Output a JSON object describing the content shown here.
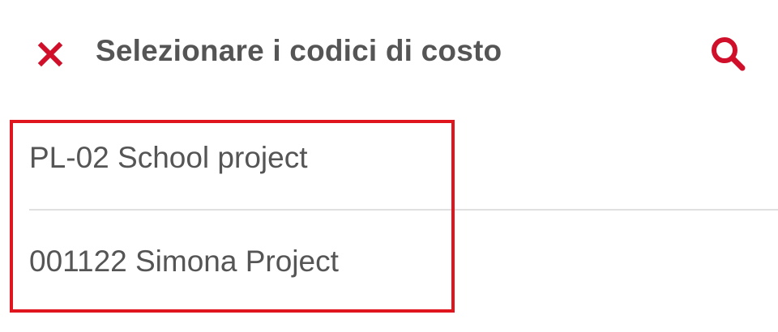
{
  "header": {
    "close_icon": "close-icon",
    "title": "Selezionare i codici di costo",
    "search_icon": "search-icon"
  },
  "cost_codes": {
    "items": [
      {
        "label": "PL-02 School project"
      },
      {
        "label": "001122 Simona Project"
      }
    ]
  },
  "colors": {
    "accent": "#d0102a",
    "text": "#555555",
    "divider": "#e0e0e0",
    "highlight": "#e0161e"
  }
}
